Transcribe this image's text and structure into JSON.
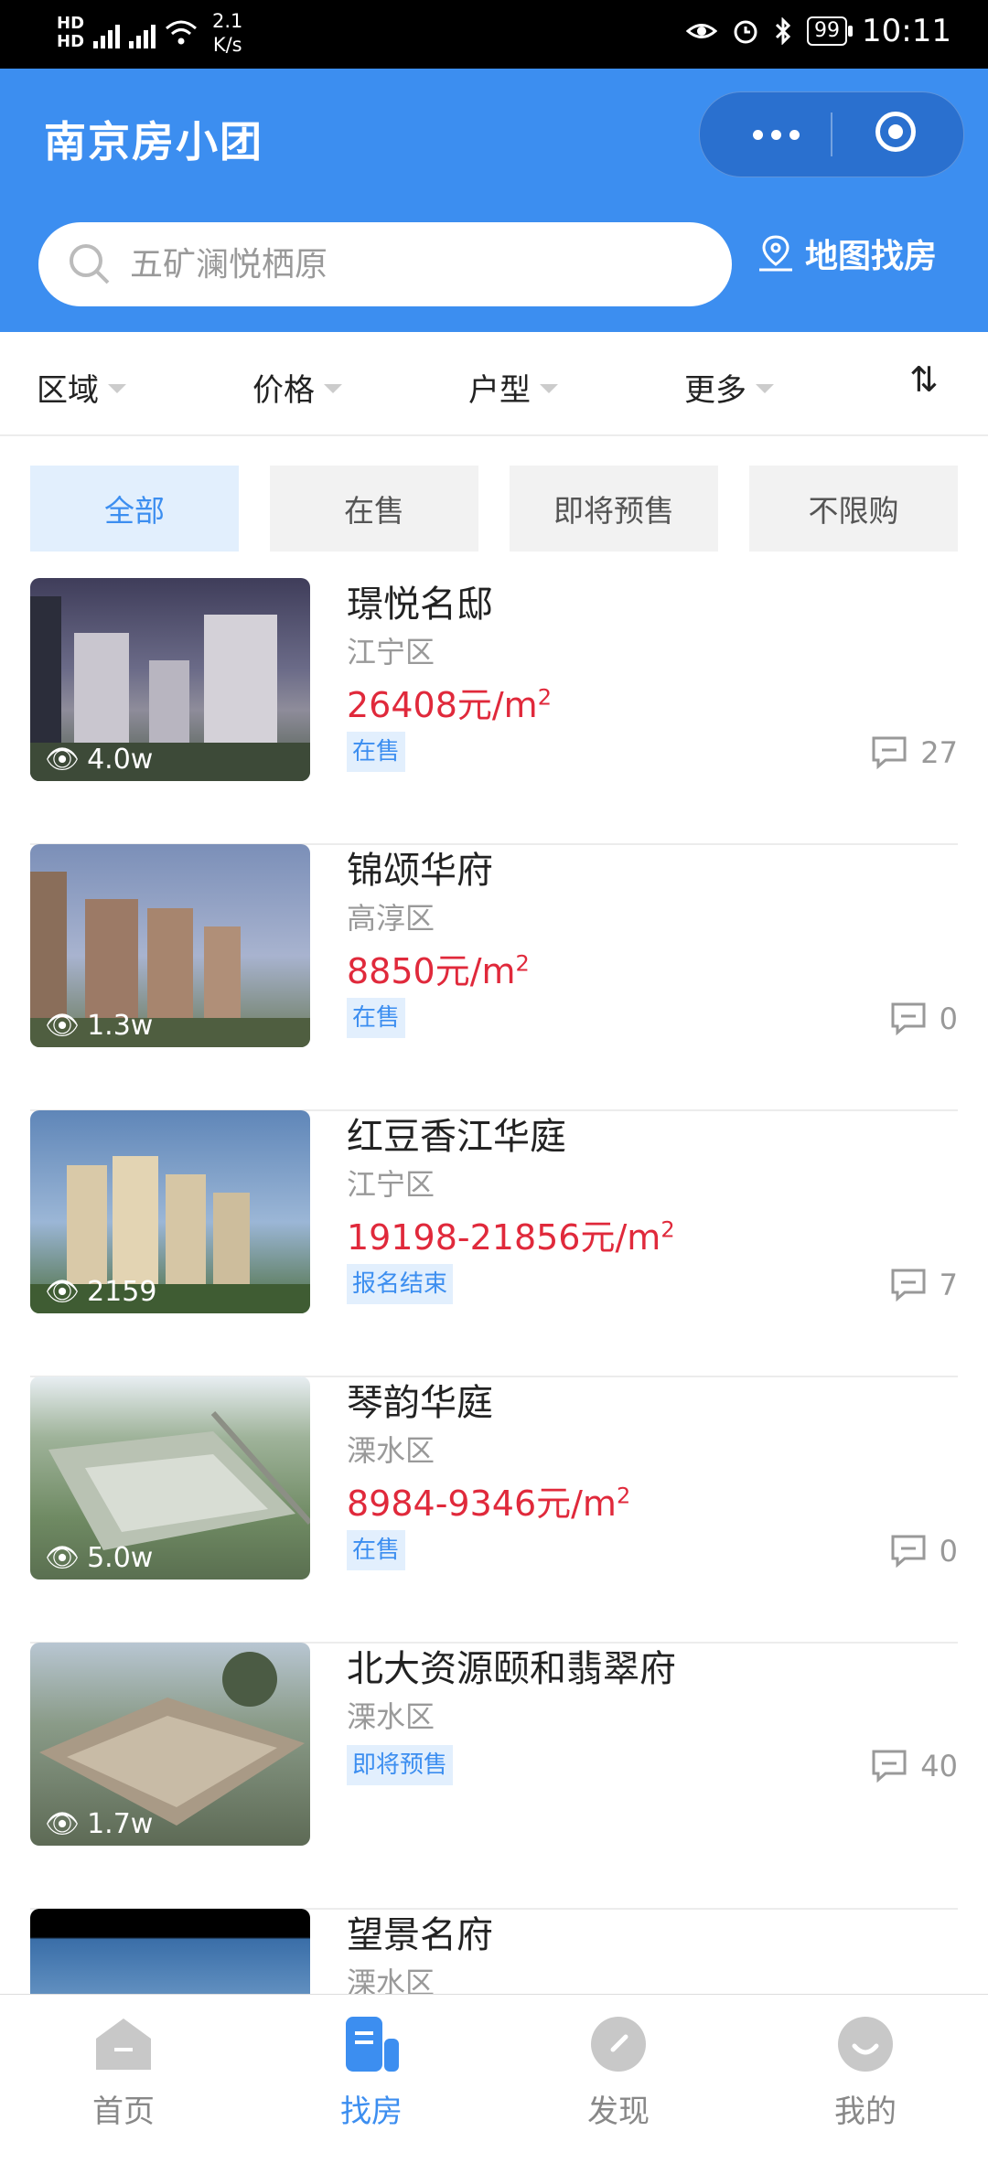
{
  "status_bar": {
    "hd1": "HD",
    "hd2": "HD",
    "net_speed": "2.1",
    "net_unit": "K/s",
    "battery": "99",
    "time": "10:11"
  },
  "header": {
    "title": "南京房小团",
    "search_placeholder": "五矿澜悦栖原",
    "map_button": "地图找房"
  },
  "filters": [
    "区域",
    "价格",
    "户型",
    "更多"
  ],
  "sort_icon": "⇅",
  "tabs": [
    "全部",
    "在售",
    "即将预售",
    "不限购"
  ],
  "listings": [
    {
      "name": "璟悦名邸",
      "district": "江宁区",
      "price": "26408元/m",
      "unit_sup": "2",
      "status": "在售",
      "views": "4.0w",
      "comments": "27"
    },
    {
      "name": "锦颂华府",
      "district": "高淳区",
      "price": "8850元/m",
      "unit_sup": "2",
      "status": "在售",
      "views": "1.3w",
      "comments": "0"
    },
    {
      "name": "红豆香江华庭",
      "district": "江宁区",
      "price": "19198-21856元/m",
      "unit_sup": "2",
      "status": "报名结束",
      "views": "2159",
      "comments": "7"
    },
    {
      "name": "琴韵华庭",
      "district": "溧水区",
      "price": "8984-9346元/m",
      "unit_sup": "2",
      "status": "在售",
      "views": "5.0w",
      "comments": "0"
    },
    {
      "name": "北大资源颐和翡翠府",
      "district": "溧水区",
      "price": "",
      "unit_sup": "",
      "status": "即将预售",
      "views": "1.7w",
      "comments": "40"
    },
    {
      "name": "望景名府",
      "district": "溧水区"
    }
  ],
  "tabbar": [
    "首页",
    "找房",
    "发现",
    "我的"
  ],
  "colors": {
    "brand": "#3c8ef0",
    "price": "#e0293b"
  }
}
